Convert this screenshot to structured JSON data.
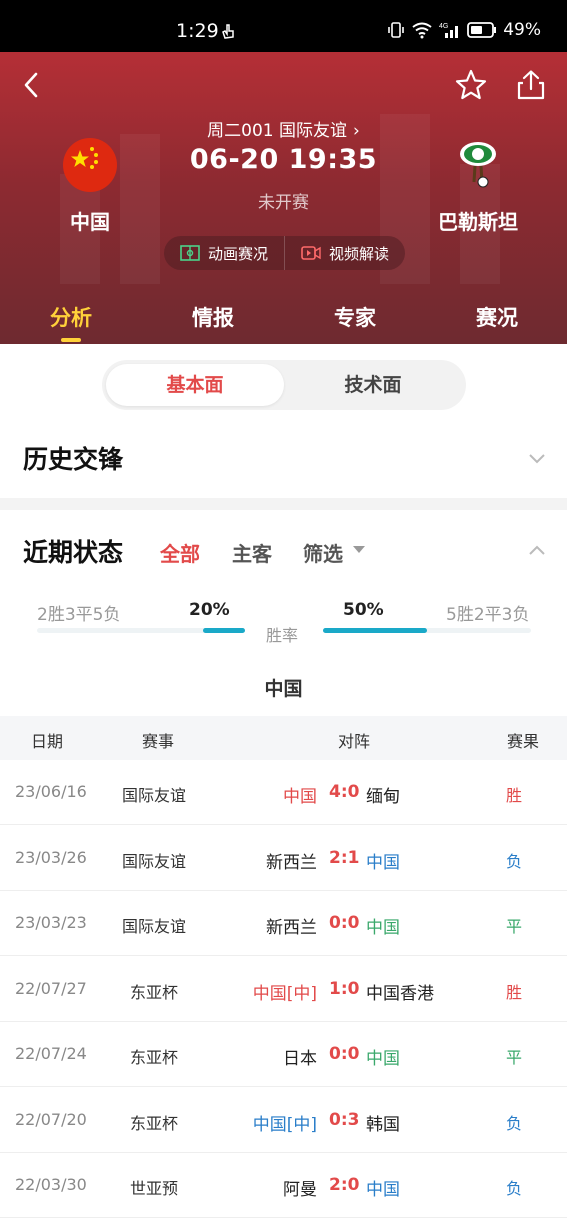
{
  "status_bar": {
    "time": "1:29",
    "battery": "49%",
    "network": "4G"
  },
  "header": {
    "match_info": "周二001  国际友谊",
    "kickoff": "06-20 19:35",
    "status": "未开赛",
    "home_team": "中国",
    "away_team": "巴勒斯坦",
    "pills": [
      "动画赛况",
      "视频解读"
    ],
    "tabs": [
      "分析",
      "情报",
      "专家",
      "赛况"
    ],
    "active_tab": "分析",
    "accent": "#ffd13a"
  },
  "segment": {
    "options": [
      "基本面",
      "技术面"
    ],
    "selected": "基本面"
  },
  "history": {
    "title": "历史交锋"
  },
  "recent": {
    "title": "近期状态",
    "filters": [
      "全部",
      "主客",
      "筛选"
    ],
    "selected_filter": "全部",
    "home_record": "2胜3平5负",
    "home_pct": "20%",
    "away_pct": "50%",
    "away_record": "5胜2平3负",
    "winrate_label": "胜率",
    "home_rate": 0.2,
    "away_rate": 0.5,
    "team_caption": "中国"
  },
  "table": {
    "headers": [
      "日期",
      "赛事",
      "对阵",
      "赛果"
    ],
    "rows": [
      {
        "date": "23/06/16",
        "comp": "国际友谊",
        "home": "中国",
        "score": "4:0",
        "away": "缅甸",
        "result": "胜"
      },
      {
        "date": "23/03/26",
        "comp": "国际友谊",
        "home": "新西兰",
        "score": "2:1",
        "away": "中国",
        "result": "负"
      },
      {
        "date": "23/03/23",
        "comp": "国际友谊",
        "home": "新西兰",
        "score": "0:0",
        "away": "中国",
        "result": "平"
      },
      {
        "date": "22/07/27",
        "comp": "东亚杯",
        "home": "中国[中]",
        "score": "1:0",
        "away": "中国香港",
        "result": "胜"
      },
      {
        "date": "22/07/24",
        "comp": "东亚杯",
        "home": "日本",
        "score": "0:0",
        "away": "中国",
        "result": "平"
      },
      {
        "date": "22/07/20",
        "comp": "东亚杯",
        "home": "中国[中]",
        "score": "0:3",
        "away": "韩国",
        "result": "负"
      },
      {
        "date": "22/03/30",
        "comp": "世亚预",
        "home": "阿曼",
        "score": "2:0",
        "away": "中国",
        "result": "负"
      }
    ]
  },
  "colors": {
    "win": "#e24a4a",
    "lose": "#2a7ec9",
    "draw": "#3aa86b",
    "rate_bar": "#1aa9c8"
  }
}
